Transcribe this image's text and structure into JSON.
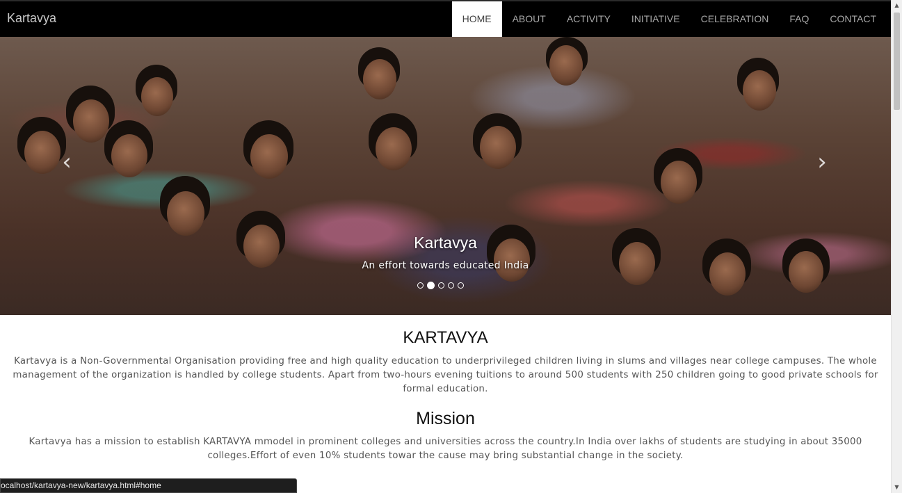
{
  "navbar": {
    "brand": "Kartavya",
    "items": [
      {
        "label": "HOME",
        "active": true
      },
      {
        "label": "ABOUT",
        "active": false
      },
      {
        "label": "ACTIVITY",
        "active": false
      },
      {
        "label": "INITIATIVE",
        "active": false
      },
      {
        "label": "CELEBRATION",
        "active": false
      },
      {
        "label": "FAQ",
        "active": false
      },
      {
        "label": "CONTACT",
        "active": false
      }
    ]
  },
  "carousel": {
    "caption_title": "Kartavya",
    "caption_subtitle": "An effort towards educated India",
    "prev_icon": "‹",
    "next_icon": "›",
    "slide_count": 5,
    "active_slide": 1
  },
  "about": {
    "title": "KARTAVYA",
    "text": "Kartavya is a Non-Governmental Organisation providing free and high quality education to underprivileged children living in slums and villages near college campuses. The whole management of the organization is handled by college students. Apart from two-hours evening tuitions to around 500 students with 250 children going to good private schools for formal education."
  },
  "mission": {
    "title": "Mission",
    "text": "Kartavya has a mission to establish KARTAVYA mmodel in prominent colleges and universities across the country.In India over lakhs of students are studying in about 35000 colleges.Effort of even 10% students towar the cause may bring substantial change in the society."
  },
  "statusbar": {
    "url": "ocalhost/kartavya-new/kartavya.html#home"
  },
  "scrollbar": {
    "up_icon": "▲",
    "down_icon": "▼"
  }
}
